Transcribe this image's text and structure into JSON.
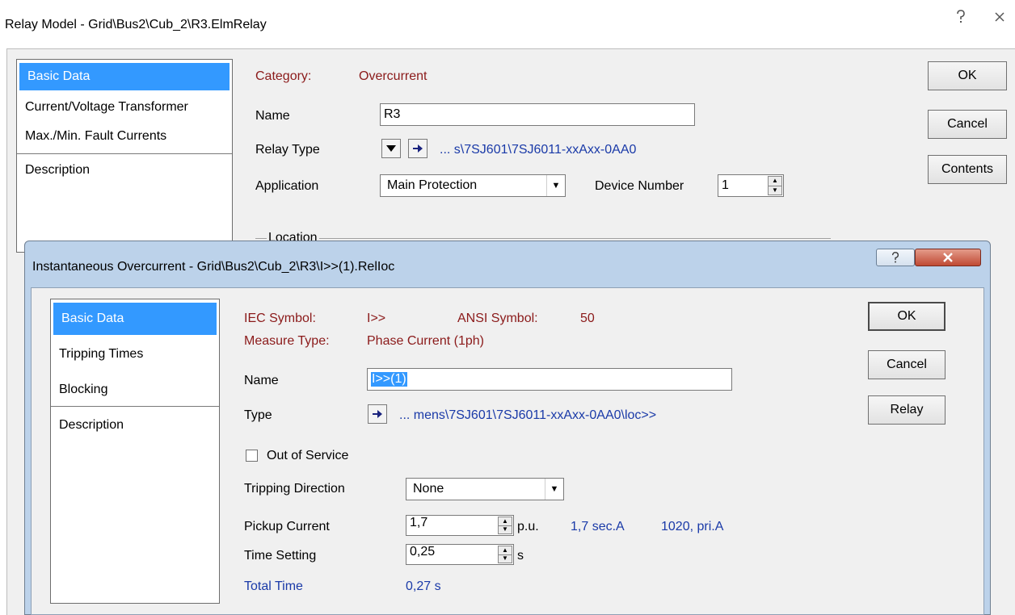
{
  "outer": {
    "title": "Relay Model - Grid\\Bus2\\Cub_2\\R3.ElmRelay",
    "nav": [
      "Basic Data",
      "Current/Voltage Transformer",
      "Max./Min. Fault Currents",
      "Description"
    ],
    "buttons": {
      "ok": "OK",
      "cancel": "Cancel",
      "contents": "Contents"
    },
    "category_label": "Category:",
    "category_value": "Overcurrent",
    "name_label": "Name",
    "name_value": "R3",
    "relay_type_label": "Relay Type",
    "relay_type_path": "... s\\7SJ601\\7SJ6011-xxAxx-0AA0",
    "application_label": "Application",
    "application_value": "Main Protection",
    "device_number_label": "Device Number",
    "device_number_value": "1",
    "location_label": "Location"
  },
  "inner": {
    "title": "Instantaneous Overcurrent - Grid\\Bus2\\Cub_2\\R3\\I>>(1).RelIoc",
    "nav": [
      "Basic Data",
      "Tripping Times",
      "Blocking",
      "Description"
    ],
    "buttons": {
      "ok": "OK",
      "cancel": "Cancel",
      "relay": "Relay"
    },
    "iec_symbol_label": "IEC Symbol:",
    "iec_symbol_value": "I>>",
    "ansi_symbol_label": "ANSI Symbol:",
    "ansi_symbol_value": "50",
    "measure_type_label": "Measure Type:",
    "measure_type_value": "Phase Current (1ph)",
    "name_label": "Name",
    "name_value": "I>>(1)",
    "type_label": "Type",
    "type_path": "... mens\\7SJ601\\7SJ6011-xxAxx-0AA0\\loc>>",
    "out_of_service_label": "Out of Service",
    "out_of_service_checked": false,
    "tripping_direction_label": "Tripping Direction",
    "tripping_direction_value": "None",
    "pickup_current_label": "Pickup Current",
    "pickup_current_value": "1,7",
    "pickup_unit": "p.u.",
    "pickup_sec": "1,7 sec.A",
    "pickup_pri": "1020, pri.A",
    "time_setting_label": "Time Setting",
    "time_setting_value": "0,25",
    "time_unit": "s",
    "total_time_label": "Total Time",
    "total_time_value": "0,27 s"
  },
  "icons": {
    "help": "help-icon",
    "close": "close-icon"
  }
}
